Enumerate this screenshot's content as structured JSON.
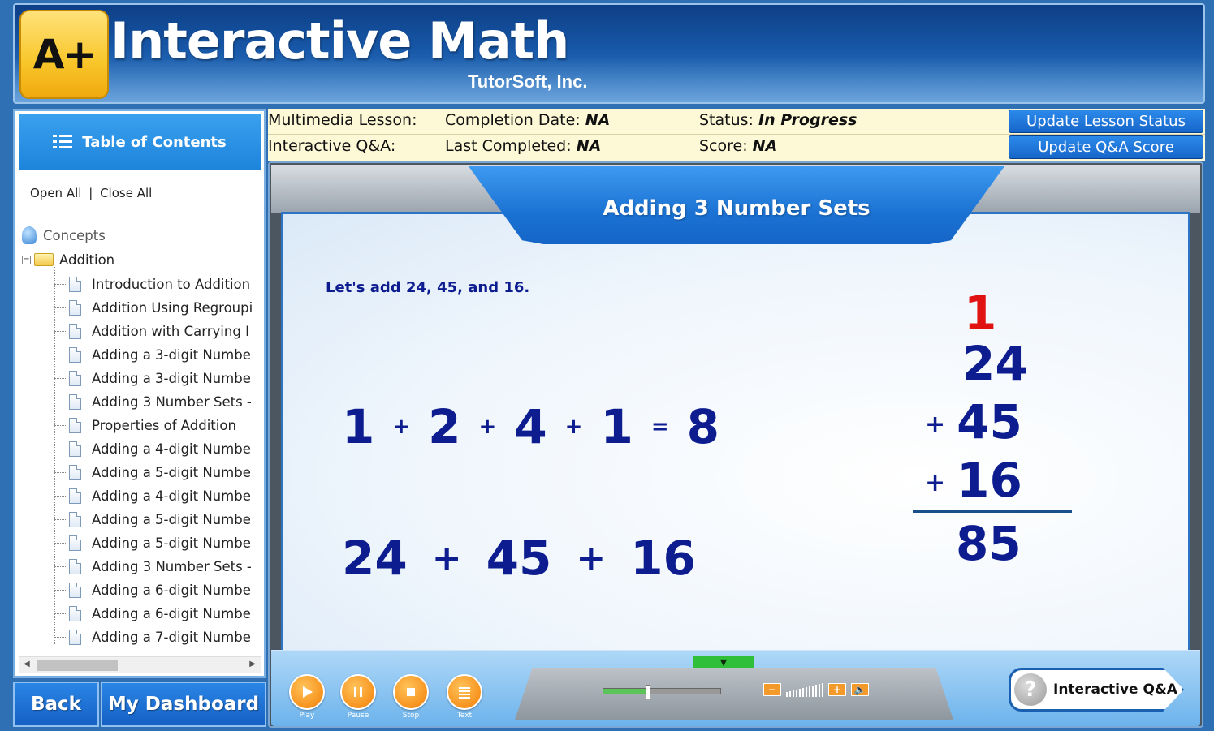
{
  "app": {
    "logo_text": "A+",
    "title": "Interactive Math",
    "company": "TutorSoft, Inc."
  },
  "sidebar": {
    "title": "Table of Contents",
    "open_all": "Open All",
    "separator": "|",
    "close_all": "Close All",
    "root": "Concepts",
    "folder": "Addition",
    "items": [
      "Introduction to Addition",
      "Addition Using Regroupi",
      "Addition with Carrying I",
      "Adding a 3-digit Numbe",
      "Adding a 3-digit Numbe",
      "Adding 3 Number Sets -",
      "Properties of Addition",
      "Adding a 4-digit Numbe",
      "Adding a 5-digit Numbe",
      "Adding a 4-digit Numbe",
      "Adding a 5-digit Numbe",
      "Adding a 5-digit Numbe",
      "Adding 3 Number Sets -",
      "Adding a 6-digit Numbe",
      "Adding a 6-digit Numbe",
      "Adding a 7-digit Numbe"
    ]
  },
  "nav": {
    "back": "Back",
    "dashboard": "My Dashboard"
  },
  "status": {
    "lesson_label": "Multimedia Lesson:",
    "completion_label": "Completion Date:",
    "completion_value": "NA",
    "status_label": "Status:",
    "status_value": "In Progress",
    "qa_label": "Interactive Q&A:",
    "last_label": "Last Completed:",
    "last_value": "NA",
    "score_label": "Score:",
    "score_value": "NA",
    "update_lesson": "Update Lesson Status",
    "update_qa": "Update Q&A Score"
  },
  "lesson": {
    "title": "Adding 3 Number Sets",
    "intro": "Let's add 24, 45, and 16.",
    "ones_row": [
      "1",
      "+",
      "2",
      "+",
      "4",
      "+",
      "1",
      "=",
      "8"
    ],
    "sum_row": [
      "24",
      "+",
      "45",
      "+",
      "16"
    ],
    "vertical": {
      "carry": "1",
      "n1": "24",
      "op2": "+",
      "n2": "45",
      "op3": "+",
      "n3": "16",
      "total": "85"
    }
  },
  "player": {
    "play": "Play",
    "pause": "Pause",
    "stop": "Stop",
    "text": "Text",
    "progress": 0.38,
    "vol_minus": "−",
    "vol_plus": "+",
    "interactive_qa": "Interactive Q&A",
    "qa_icon": "?"
  },
  "colors": {
    "accent_blue": "#1d84dc",
    "math_blue": "#0d1d8f",
    "carry_red": "#e01212",
    "control_orange": "#f7931e"
  }
}
